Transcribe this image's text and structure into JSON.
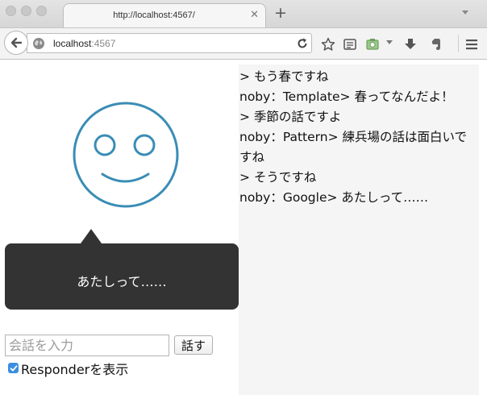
{
  "browser": {
    "tab_title": "http://localhost:4567/",
    "tab_close": "✕",
    "new_tab": "+",
    "url_host": "localhost",
    "url_port": ":4567"
  },
  "bubble": {
    "text": "あたしって……"
  },
  "input": {
    "placeholder": "会話を入力",
    "value": ""
  },
  "talk_button": {
    "label": "話す"
  },
  "responder_toggle": {
    "label": "Responderを表示",
    "checked": true
  },
  "log": [
    "> もう春ですね",
    "noby：Template> 春ってなんだよ！",
    "> 季節の話ですよ",
    "noby：Pattern> 練兵場の話は面白いですね",
    "> そうですね",
    "noby：Google> あたしって……"
  ],
  "colors": {
    "face_stroke": "#3a8db5",
    "bubble_bg": "#333333",
    "log_bg": "#f5f5f5",
    "checkbox": "#3b8ede"
  },
  "icons": {
    "face": "smiley-face-icon",
    "toolbar": [
      "star-icon",
      "reading-list-icon",
      "screenshot-icon",
      "download-icon",
      "evernote-icon",
      "menu-icon"
    ]
  }
}
